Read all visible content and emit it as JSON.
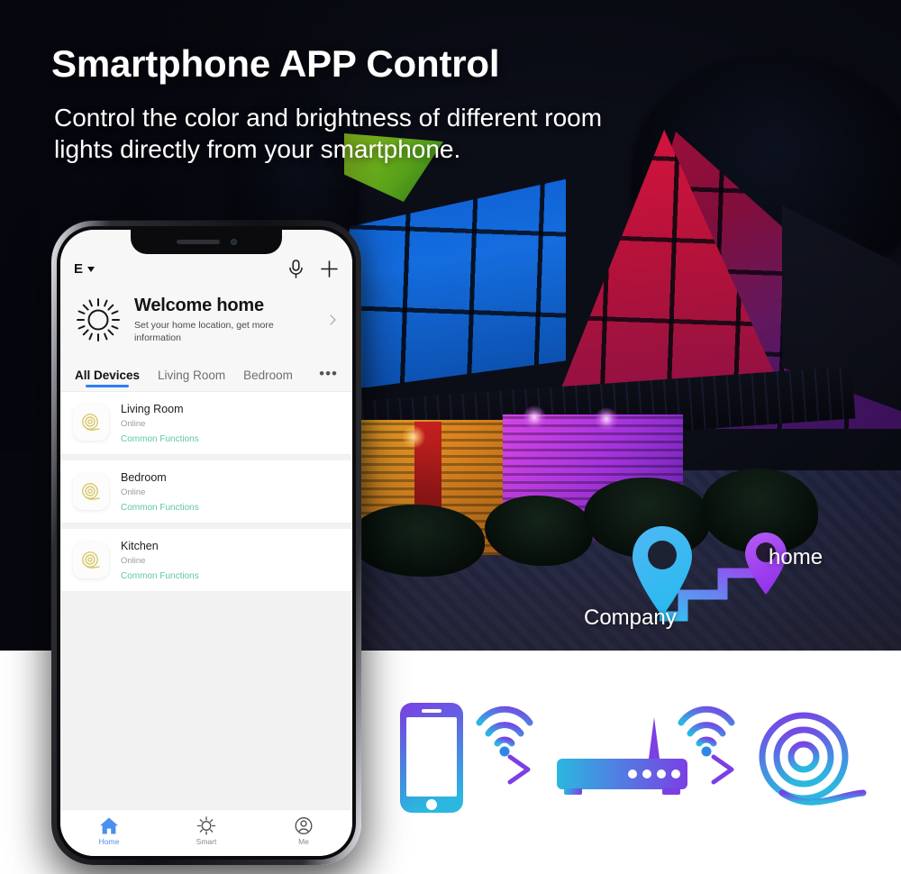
{
  "headline": {
    "title": "Smartphone APP Control",
    "subtitle": "Control the color and brightness of different room lights directly from your smartphone."
  },
  "phone_app": {
    "statusbar": {
      "notch": "iphone-notch"
    },
    "appbar": {
      "account_letter": "E",
      "account_chevron": "chevron-down-icon",
      "mic_icon": "microphone-icon",
      "add_icon": "plus-icon"
    },
    "welcome": {
      "icon": "sun-icon",
      "title": "Welcome home",
      "subtitle": "Set your home location, get more information",
      "chevron": "chevron-right-icon"
    },
    "tabs": [
      {
        "label": "All Devices",
        "active": true
      },
      {
        "label": "Living Room",
        "active": false
      },
      {
        "label": "Bedroom",
        "active": false
      }
    ],
    "tabs_more": "•••",
    "devices": [
      {
        "name": "Living Room",
        "status": "Online",
        "function": "Common Functions",
        "icon": "led-strip-reel-icon"
      },
      {
        "name": "Bedroom",
        "status": "Online",
        "function": "Common Functions",
        "icon": "led-strip-reel-icon"
      },
      {
        "name": "Kitchen",
        "status": "Online",
        "function": "Common Functions",
        "icon": "led-strip-reel-icon"
      }
    ],
    "bottom_nav": [
      {
        "label": "Home",
        "icon": "home-icon",
        "active": true
      },
      {
        "label": "Smart",
        "icon": "sun-icon",
        "active": false
      },
      {
        "label": "Me",
        "icon": "person-icon",
        "active": false
      }
    ]
  },
  "map_pins": {
    "company": {
      "label": "Company",
      "icon": "map-pin-icon",
      "color": "#2fb6f0"
    },
    "home": {
      "label": "home",
      "icon": "map-pin-icon",
      "color": "#a13ef0"
    },
    "route": "route-path"
  },
  "flow_diagram": {
    "steps": [
      {
        "icon": "smartphone-icon"
      },
      {
        "icon": "wifi-signal-icon"
      },
      {
        "icon": "arrow-right-icon"
      },
      {
        "icon": "router-icon"
      },
      {
        "icon": "wifi-signal-icon"
      },
      {
        "icon": "arrow-right-icon"
      },
      {
        "icon": "led-strip-reel-icon"
      }
    ]
  },
  "colors": {
    "accent_green": "#5fc6a4",
    "accent_blue": "#2f7df6",
    "nav_active": "#4a90f0",
    "gradient_start": "#7b3fe4",
    "gradient_end": "#2bb7e0",
    "pin_company": "#2fb6f0",
    "pin_home": "#a13ef0"
  }
}
